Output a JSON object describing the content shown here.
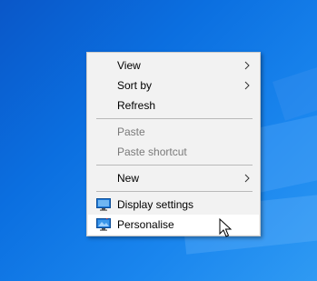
{
  "menu": {
    "items": [
      {
        "label": "View",
        "has_submenu": true,
        "enabled": true
      },
      {
        "label": "Sort by",
        "has_submenu": true,
        "enabled": true
      },
      {
        "label": "Refresh",
        "has_submenu": false,
        "enabled": true
      },
      {
        "label": "Paste",
        "has_submenu": false,
        "enabled": false
      },
      {
        "label": "Paste shortcut",
        "has_submenu": false,
        "enabled": false
      },
      {
        "label": "New",
        "has_submenu": true,
        "enabled": true
      },
      {
        "label": "Display settings",
        "has_submenu": false,
        "enabled": true,
        "icon": "display-icon"
      },
      {
        "label": "Personalise",
        "has_submenu": false,
        "enabled": true,
        "icon": "personalise-icon",
        "hovered": true
      }
    ]
  },
  "colors": {
    "desktop_background": "#0b6fe0",
    "menu_background": "#f2f2f2",
    "hover_background": "#ffffff",
    "disabled_text": "#7a7a7a"
  }
}
